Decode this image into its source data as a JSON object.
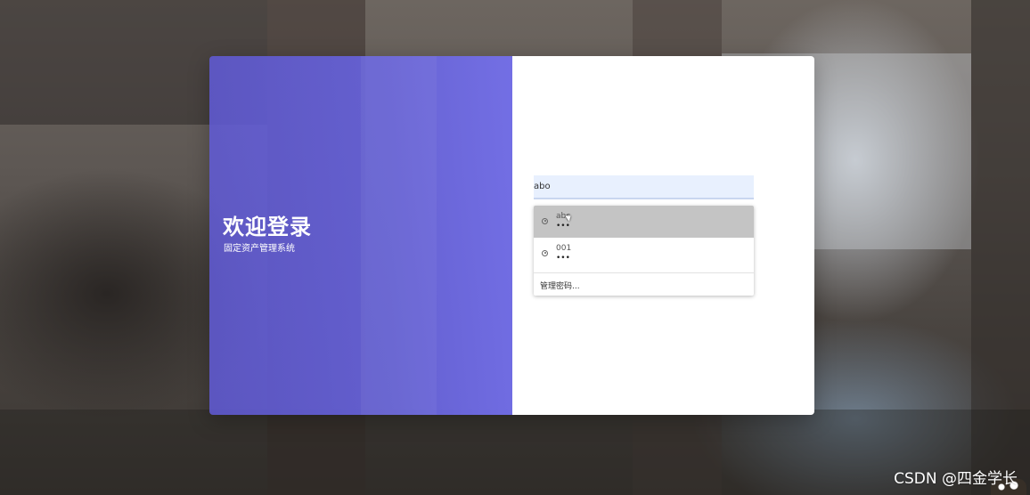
{
  "welcome": {
    "title": "欢迎登录",
    "subtitle": "固定资产管理系统"
  },
  "login_form": {
    "username_value": "abo"
  },
  "autofill": {
    "suggestions": [
      {
        "username": "abc",
        "password_mask": "•••",
        "icon": "key-icon"
      },
      {
        "username": "001",
        "password_mask": "•••",
        "icon": "key-icon"
      }
    ],
    "manage_label": "管理密码..."
  },
  "watermark": {
    "text": "CSDN @四金学长"
  },
  "colors": {
    "welcome_panel": "#6a64e0",
    "input_fill": "#e8f0fe",
    "hover_row": "#c4c4c4"
  }
}
